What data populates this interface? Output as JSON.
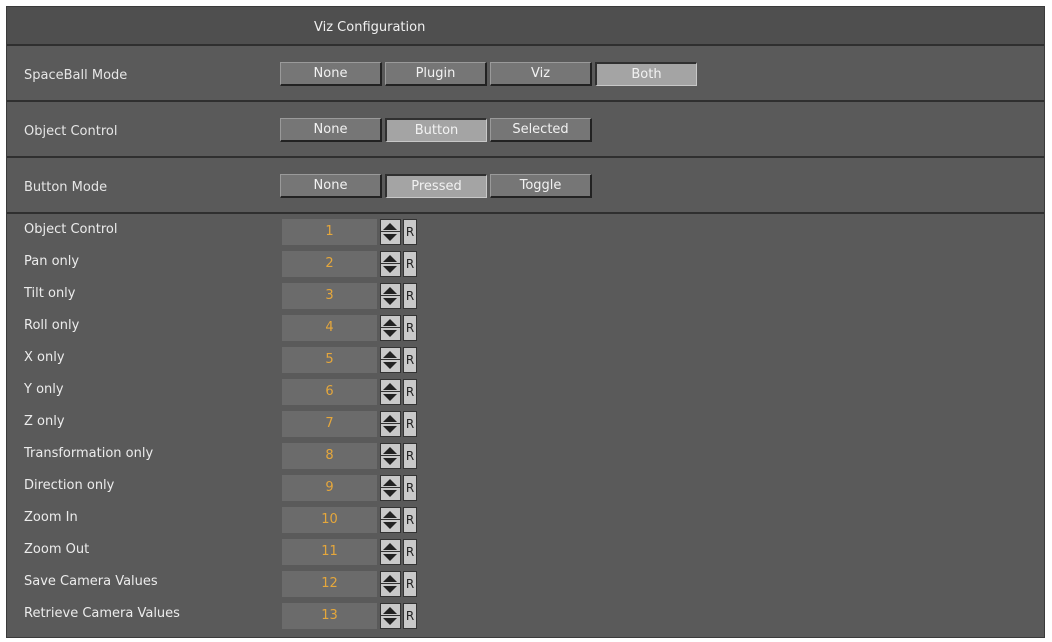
{
  "title": "Viz Configuration",
  "modes": [
    {
      "label": "SpaceBall Mode",
      "options": [
        "None",
        "Plugin",
        "Viz",
        "Both"
      ],
      "selected": "Both"
    },
    {
      "label": "Object Control",
      "options": [
        "None",
        "Button",
        "Selected"
      ],
      "selected": "Button"
    },
    {
      "label": "Button Mode",
      "options": [
        "None",
        "Pressed",
        "Toggle"
      ],
      "selected": "Pressed"
    }
  ],
  "button_rows": [
    {
      "label": "Object Control",
      "value": "1"
    },
    {
      "label": "Pan only",
      "value": "2"
    },
    {
      "label": "Tilt only",
      "value": "3"
    },
    {
      "label": "Roll only",
      "value": "4"
    },
    {
      "label": "X only",
      "value": "5"
    },
    {
      "label": "Y only",
      "value": "6"
    },
    {
      "label": "Z only",
      "value": "7"
    },
    {
      "label": "Transformation only",
      "value": "8"
    },
    {
      "label": "Direction only",
      "value": "9"
    },
    {
      "label": "Zoom In",
      "value": "10"
    },
    {
      "label": "Zoom Out",
      "value": "11"
    },
    {
      "label": "Save Camera Values",
      "value": "12"
    },
    {
      "label": "Retrieve Camera Values",
      "value": "13"
    }
  ],
  "reset_label": "R",
  "icons": {
    "spinner": "up-down-spinner-icon"
  },
  "colors": {
    "panel_bg": "#5a5a5a",
    "value_text": "#e5a73c",
    "active_segment": "#a4a4a4"
  }
}
